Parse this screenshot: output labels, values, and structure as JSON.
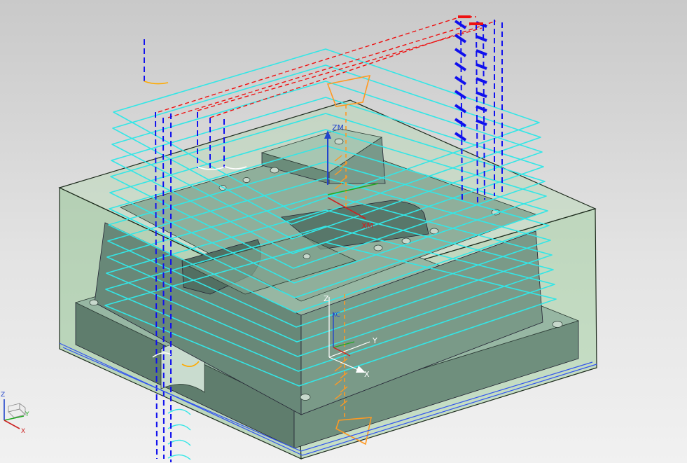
{
  "viewport": {
    "colors": {
      "stock": "#9cc89a",
      "stock_edge": "#1d2b1d",
      "part": "#6e8e7c",
      "part_light": "#9dbcaa",
      "toolpath_cut": "#33e6e6",
      "toolpath_engage": "#1010ee",
      "toolpath_rapid": "#ee1111",
      "tool_holder": "#ff9922",
      "machine_csys": "#2244cc"
    },
    "mcs_labels": {
      "zm": "ZM",
      "xm": "XM"
    },
    "wcs_labels": {
      "z": "Z",
      "y": "Y",
      "x": "X",
      "origin": "XC"
    },
    "triad_labels": {
      "z": "Z",
      "y": "Y",
      "x": "X"
    }
  }
}
